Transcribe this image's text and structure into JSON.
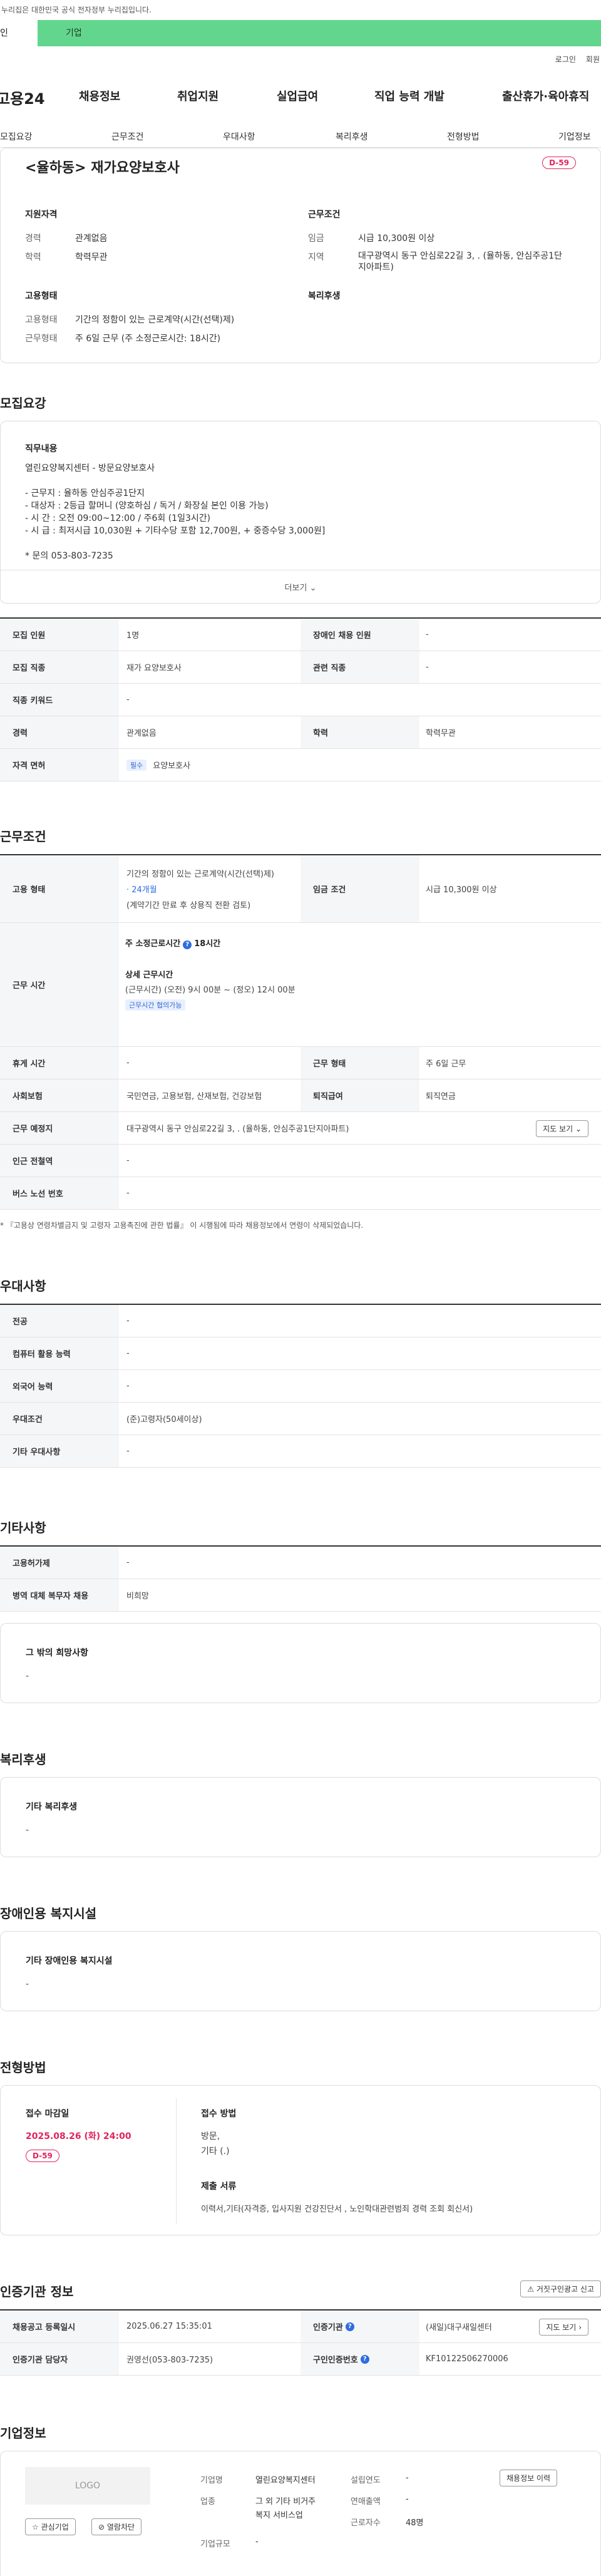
{
  "banner": {
    "text": "누리집은 대한민국 공식 전자정부 누리집입니다."
  },
  "tabs": {
    "personal": "인",
    "corporate": "기업"
  },
  "util": {
    "login": "로그인",
    "join": "회원"
  },
  "gnb": {
    "logo": "고용24",
    "items": [
      "채용정보",
      "취업지원",
      "실업급여",
      "직업 능력 개발",
      "출산휴가·육아휴직"
    ]
  },
  "snb": [
    "모집요강",
    "근무조건",
    "우대사항",
    "복리후생",
    "전형방법",
    "기업정보"
  ],
  "job": {
    "title": "<율하동> 재가요양보호사",
    "dday": "D-59",
    "summary": {
      "qualification_h": "지원자격",
      "career_k": "경력",
      "career_v": "관계없음",
      "edu_k": "학력",
      "edu_v": "학력무관",
      "workcond_h": "근무조건",
      "wage_k": "임금",
      "wage_v": "시급 10,300원 이상",
      "region_k": "지역",
      "region_v1": "대구광역시 동구 안심로22길 3, . (율하동, 안심주공1단",
      "region_v2": "지아파트)",
      "employ_h": "고용형태",
      "type_k": "고용형태",
      "type_v": "기간의 정함이 있는 근로계약(시간(선택)제)",
      "form_k": "근무형태",
      "form_v": "주 6일 근무 (주 소정근로시간: 18시간)",
      "welfare_h": "복리후생"
    }
  },
  "recruit": {
    "heading": "모집요강",
    "duty_h": "직무내용",
    "lines": [
      "열린요양복지센터 -  방문요양보호사",
      "",
      "- 근무지 : 율하동 안심주공1단지",
      "- 대상자 : 2등급 할머니 (양호하심 / 독거 / 화장실 본인 이용 가능)",
      "- 시   간 : 오전 09:00~12:00  / 주6회 (1일3시간)",
      "- 시   급 :  최저시급 10,030원 + 기타수당 포함 12,700원, + 중증수당 3,000원]",
      "",
      "* 문의  053-803-7235"
    ],
    "more": "더보기",
    "rows": [
      {
        "k": "모집 인원",
        "v": "1명",
        "k2": "장애인 채용 인원",
        "v2": "-"
      },
      {
        "k": "모집 직종",
        "v": "재가 요양보호사",
        "k2": "관련 직종",
        "v2": "-"
      },
      {
        "k": "직종 키워드",
        "v": "-"
      },
      {
        "k": "경력",
        "v": "관계없음",
        "k2": "학력",
        "v2": "학력무관"
      },
      {
        "k": "자격 면허",
        "tag": "필수",
        "v": "요양보호사"
      }
    ]
  },
  "work": {
    "heading": "근무조건",
    "type_k": "고용 형태",
    "type_v1": "기간의 정함이 있는 근로계약(시간(선택)제)",
    "type_v2": "· 24개월",
    "type_v3": "(계약기간 만료 후 상용직 전환 검토)",
    "wage_k": "임금 조건",
    "wage_v": "시급 10,300원 이상",
    "time_k": "근무 시간",
    "time_week": "주 소정근로시간",
    "time_week_v": "18시간",
    "time_detail_h": "상세 근무시간",
    "time_detail_v": "(근무시간) (오전) 9시 00분 ~ (정오) 12시 00분",
    "time_tag": "근무시간 협의가능",
    "rest_k": "휴게 시간",
    "rest_v": "-",
    "form_k": "근무 형태",
    "form_v": "주 6일 근무",
    "ins_k": "사회보험",
    "ins_v": "국민연금, 고용보험, 산재보험, 건강보험",
    "sev_k": "퇴직급여",
    "sev_v": "퇴직연금",
    "place_k": "근무 예정지",
    "place_v": "대구광역시 동구 안심로22길 3, . (율하동, 안심주공1단지아파트)",
    "map_btn": "지도 보기",
    "subway_k": "인근 전철역",
    "subway_v": "-",
    "bus_k": "버스 노선 번호",
    "bus_v": "-",
    "note": "* 『고용상 연령차별금지 및 고령자 고용촉진에 관한 법률』 이 시행됨에 따라 채용정보에서 연령이 삭제되었습니다."
  },
  "pref": {
    "heading": "우대사항",
    "rows": [
      {
        "k": "전공",
        "v": "-"
      },
      {
        "k": "컴퓨터 활용 능력",
        "v": "-"
      },
      {
        "k": "외국어 능력",
        "v": "-"
      },
      {
        "k": "우대조건",
        "v": "(준)고령자(50세이상)"
      },
      {
        "k": "기타 우대사항",
        "v": "-"
      }
    ]
  },
  "etc": {
    "heading": "기타사항",
    "rows": [
      {
        "k": "고용허가제",
        "v": "-"
      },
      {
        "k": "병역 대체 복무자 채용",
        "v": "비희망"
      }
    ],
    "box_h": "그 밖의 희망사항",
    "box_v": "-"
  },
  "welfare": {
    "heading": "복리후생",
    "box_h": "기타 복리후생",
    "box_v": "-"
  },
  "disabled": {
    "heading": "장애인용 복지시설",
    "box_h": "기타 장애인용 복지시설",
    "box_v": "-"
  },
  "selection": {
    "heading": "전형방법",
    "deadline_h": "접수 마감일",
    "deadline_v": "2025.08.26 (화) 24:00",
    "dday": "D-59",
    "method_h": "접수 방법",
    "method_v1": "방문,",
    "method_v2": "기타 (.)",
    "docs_h": "제출 서류",
    "docs_v": "이력서,기타(자격증, 입사지원 건강진단서 , 노인학대관련범죄 경력 조회 회신서)"
  },
  "cert": {
    "heading": "인증기관 정보",
    "report_btn": "거짓구인광고 신고",
    "rows": [
      {
        "k": "채용공고 등록일시",
        "v": "2025.06.27 15:35:01",
        "k2": "인증기관",
        "v2": "(새일)대구새일센터"
      },
      {
        "k": "인증기관 담당자",
        "v": "권영선(053-803-7235)",
        "k2": "구인인증번호",
        "v2": "KF10122506270006"
      }
    ],
    "map_btn": "지도 보기"
  },
  "company": {
    "heading": "기업정보",
    "logo": "LOGO",
    "fav_btn": "관심기업",
    "block_btn": "열람차단",
    "name_k": "기업명",
    "name_v": "열린요양복지센터",
    "ind_k": "업종",
    "ind_v1": "그 외 기타 비거주",
    "ind_v2": "복지 서비스업",
    "size_k": "기업규모",
    "size_v": "-",
    "founded_k": "설립연도",
    "founded_v": "-",
    "sales_k": "연매출액",
    "sales_v": "-",
    "emp_k": "근로자수",
    "emp_v": "48명",
    "history_btn": "채용정보 이력"
  }
}
